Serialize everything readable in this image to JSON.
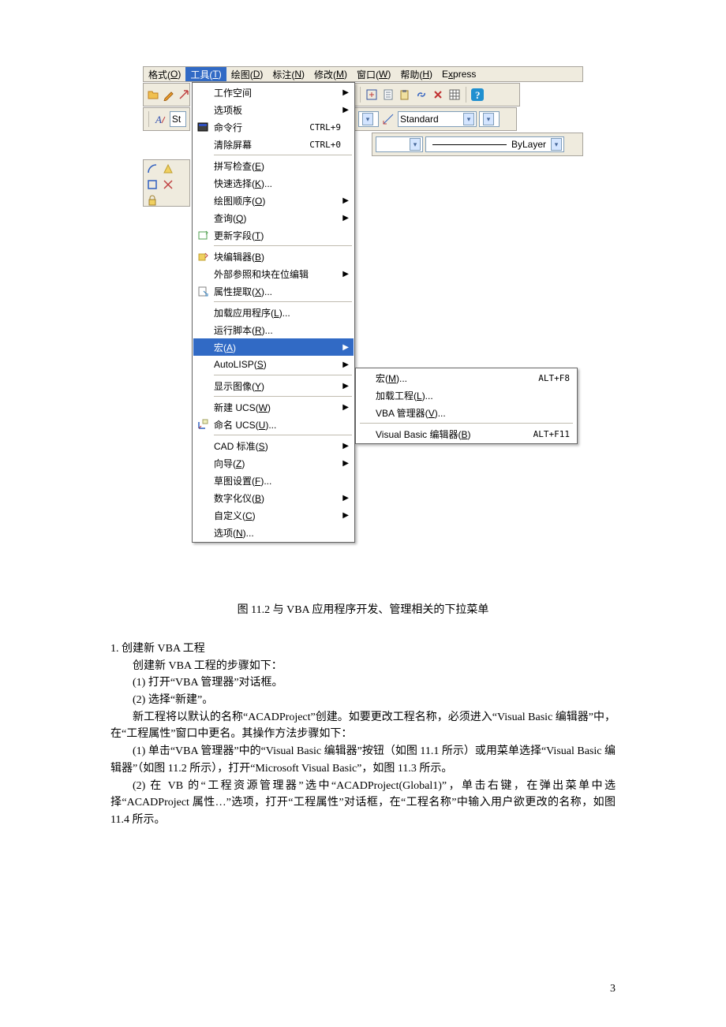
{
  "menubar": {
    "items": [
      {
        "label": "格式(O)",
        "u": "O"
      },
      {
        "label": "工具(T)",
        "u": "T",
        "hl": true
      },
      {
        "label": "绘图(D)",
        "u": "D"
      },
      {
        "label": "标注(N)",
        "u": "N"
      },
      {
        "label": "修改(M)",
        "u": "M"
      },
      {
        "label": "窗口(W)",
        "u": "W"
      },
      {
        "label": "帮助(H)",
        "u": "H"
      },
      {
        "label": "Express",
        "u": "x"
      }
    ]
  },
  "combo": {
    "standard": "Standard",
    "bylayer": "ByLayer"
  },
  "menu": [
    {
      "t": "i",
      "label": "工作空间",
      "arrow": true
    },
    {
      "t": "i",
      "label": "选项板",
      "arrow": true
    },
    {
      "t": "i",
      "label": "命令行",
      "short": "CTRL+9",
      "icon": "cmd"
    },
    {
      "t": "i",
      "label": "清除屏幕",
      "short": "CTRL+0"
    },
    {
      "t": "s"
    },
    {
      "t": "i",
      "label": "拼写检查(E)"
    },
    {
      "t": "i",
      "label": "快速选择(K)..."
    },
    {
      "t": "i",
      "label": "绘图顺序(O)",
      "arrow": true
    },
    {
      "t": "i",
      "label": "查询(Q)",
      "arrow": true
    },
    {
      "t": "i",
      "label": "更新字段(T)",
      "icon": "upd"
    },
    {
      "t": "s"
    },
    {
      "t": "i",
      "label": "块编辑器(B)",
      "icon": "blk"
    },
    {
      "t": "i",
      "label": "外部参照和块在位编辑",
      "arrow": true
    },
    {
      "t": "i",
      "label": "属性提取(X)...",
      "icon": "ext"
    },
    {
      "t": "s"
    },
    {
      "t": "i",
      "label": "加载应用程序(L)..."
    },
    {
      "t": "i",
      "label": "运行脚本(R)..."
    },
    {
      "t": "i",
      "label": "宏(A)",
      "arrow": true,
      "hl": true
    },
    {
      "t": "i",
      "label": "AutoLISP(S)",
      "arrow": true
    },
    {
      "t": "s"
    },
    {
      "t": "i",
      "label": "显示图像(Y)",
      "arrow": true
    },
    {
      "t": "s"
    },
    {
      "t": "i",
      "label": "新建 UCS(W)",
      "arrow": true
    },
    {
      "t": "i",
      "label": "命名 UCS(U)...",
      "icon": "ucs"
    },
    {
      "t": "s"
    },
    {
      "t": "i",
      "label": "CAD 标准(S)",
      "arrow": true
    },
    {
      "t": "i",
      "label": "向导(Z)",
      "arrow": true
    },
    {
      "t": "i",
      "label": "草图设置(F)..."
    },
    {
      "t": "i",
      "label": "数字化仪(B)",
      "arrow": true
    },
    {
      "t": "i",
      "label": "自定义(C)",
      "arrow": true
    },
    {
      "t": "i",
      "label": "选项(N)..."
    }
  ],
  "submenu": [
    {
      "t": "i",
      "label": "宏(M)...",
      "short": "ALT+F8"
    },
    {
      "t": "i",
      "label": "加载工程(L)..."
    },
    {
      "t": "i",
      "label": "VBA 管理器(V)..."
    },
    {
      "t": "s"
    },
    {
      "t": "i",
      "label": "Visual Basic 编辑器(B)",
      "short": "ALT+F11"
    }
  ],
  "caption": "图 11.2    与 VBA 应用程序开发、管理相关的下拉菜单",
  "text": {
    "h1": "1.  创建新 VBA 工程",
    "p1": "创建新 VBA 工程的步骤如下：",
    "p2": "(1)  打开“VBA 管理器”对话框。",
    "p3": "(2)  选择“新建”。",
    "p4": "新工程将以默认的名称“ACADProject”创建。如要更改工程名称，必须进入“Visual Basic 编辑器”中，在“工程属性”窗口中更名。其操作方法步骤如下：",
    "p5": "(1)  单击“VBA 管理器”中的“Visual Basic 编辑器”按钮（如图 11.1 所示）或用菜单选择“Visual Basic 编辑器”（如图 11.2 所示），打开“Microsoft Visual Basic”，如图 11.3 所示。",
    "p6": "(2)  在 VB 的“工程资源管理器”选中“ACADProject(Global1)”，单击右键，在弹出菜单中选择“ACADProject 属性…”选项，打开“工程属性”对话框，在“工程名称”中输入用户欲更改的名称，如图 11.4 所示。"
  },
  "pagenum": "3"
}
